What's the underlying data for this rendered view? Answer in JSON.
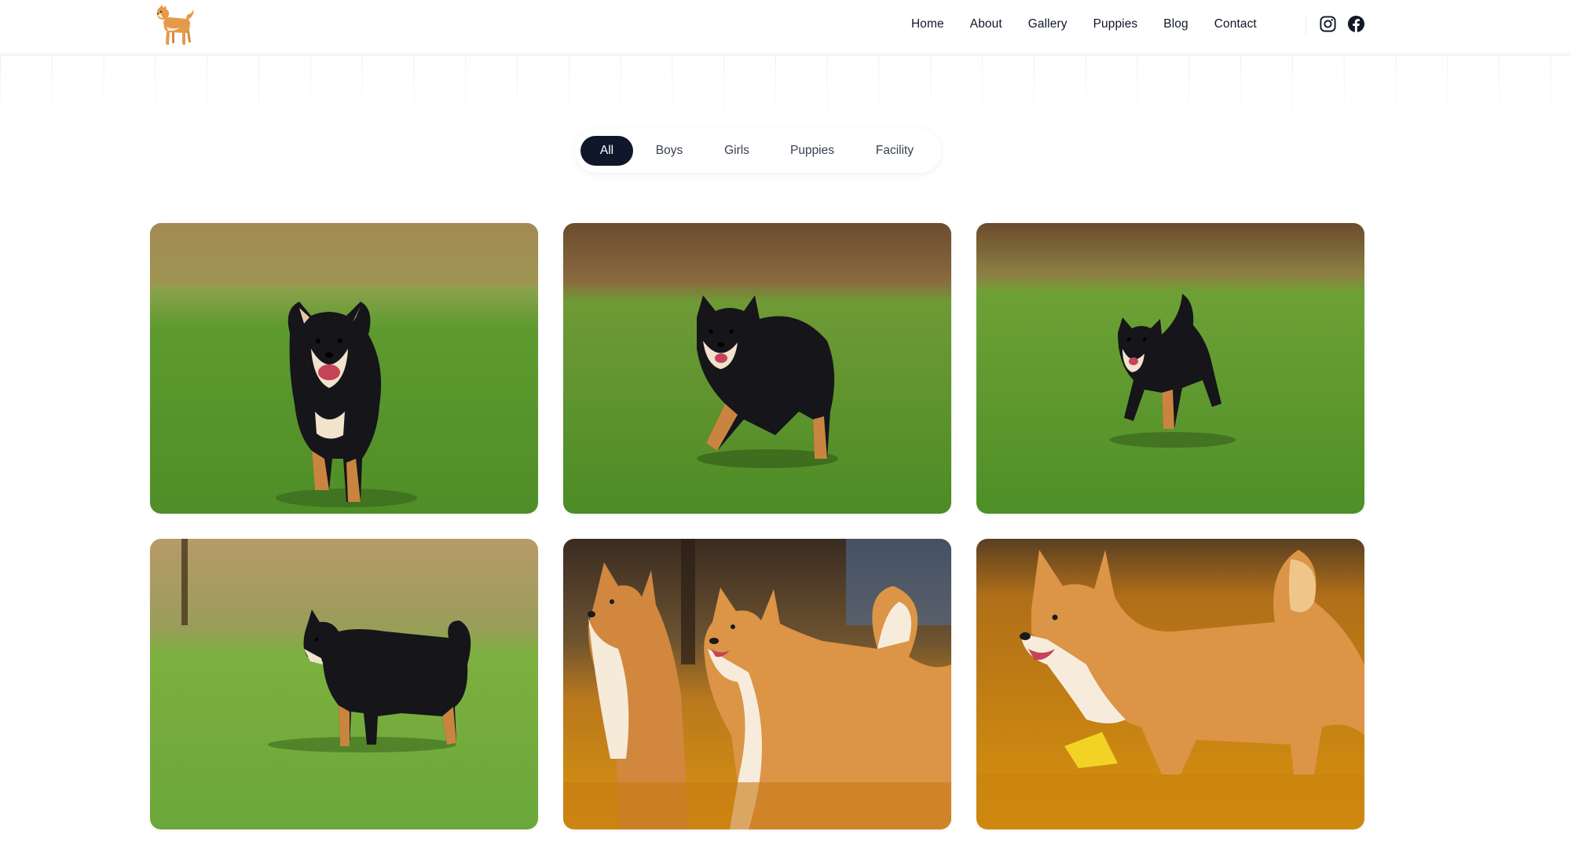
{
  "header": {
    "logo_icon": "shiba-dog-logo-icon",
    "nav": [
      {
        "label": "Home"
      },
      {
        "label": "About"
      },
      {
        "label": "Gallery"
      },
      {
        "label": "Puppies"
      },
      {
        "label": "Blog"
      },
      {
        "label": "Contact"
      }
    ],
    "social": [
      {
        "icon": "instagram-icon"
      },
      {
        "icon": "facebook-icon"
      }
    ]
  },
  "filters": {
    "tabs": [
      {
        "label": "All",
        "active": true
      },
      {
        "label": "Boys",
        "active": false
      },
      {
        "label": "Girls",
        "active": false
      },
      {
        "label": "Puppies",
        "active": false
      },
      {
        "label": "Facility",
        "active": false
      }
    ]
  },
  "gallery": {
    "photos": [
      {
        "subject": "black-and-tan-shiba-puppy-running-toward-camera"
      },
      {
        "subject": "black-and-tan-shiba-bounding-across-grass"
      },
      {
        "subject": "black-and-tan-shiba-trotting-on-lawn"
      },
      {
        "subject": "black-and-tan-shiba-standing-side-profile"
      },
      {
        "subject": "two-red-shibas-in-autumn-leaves"
      },
      {
        "subject": "red-shiba-walking-through-autumn-leaves"
      }
    ]
  },
  "colors": {
    "active_pill": "#0f172a",
    "grass": "#5a9a2e",
    "autumn": "#d98e12",
    "shiba_red": "#d78b3c",
    "shiba_black": "#15151a"
  }
}
